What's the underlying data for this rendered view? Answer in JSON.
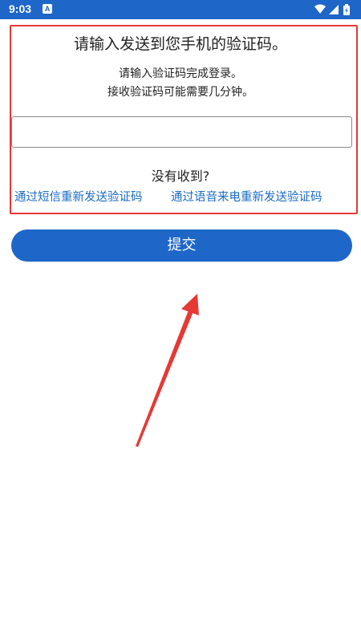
{
  "status_bar": {
    "time": "9:03",
    "notification_icon": "A",
    "icons": [
      "wifi-icon",
      "signal-icon",
      "battery-icon"
    ],
    "color": "#1e66c8"
  },
  "verify": {
    "title": "请输入发送到您手机的验证码。",
    "instruction_line1": "请输入验证码完成登录。",
    "instruction_line2": "接收验证码可能需要几分钟。",
    "code_value": "",
    "not_received": "没有收到?",
    "resend_sms": "通过短信重新发送验证码",
    "resend_voice": "通过语音来电重新发送验证码"
  },
  "submit_label": "提交",
  "colors": {
    "accent": "#1e66c8",
    "link": "#1a6bc4",
    "highlight": "#e53935"
  }
}
